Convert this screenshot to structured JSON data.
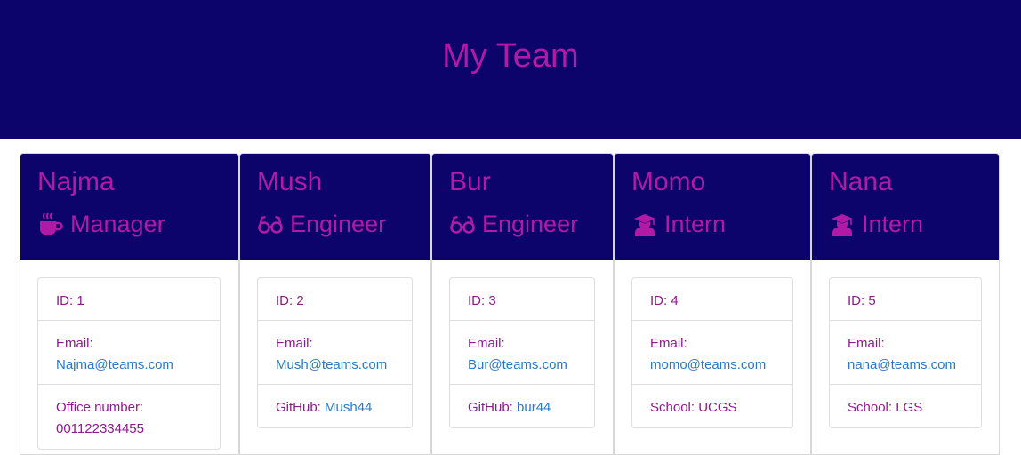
{
  "page": {
    "title": "My Team"
  },
  "colors": {
    "header_bg": "#0c036b",
    "accent": "#b01aa6",
    "link": "#2a79c9",
    "text": "#8c1b8a"
  },
  "employees": [
    {
      "name": "Najma",
      "role": "Manager",
      "icon": "coffee-mug-icon",
      "id": "ID: 1",
      "email_label": "Email:",
      "email": "Najma@teams.com",
      "extra_label": "Office number:",
      "extra_value": "001122334455"
    },
    {
      "name": "Mush",
      "role": "Engineer",
      "icon": "glasses-icon",
      "id": "ID: 2",
      "email_label": "Email:",
      "email": "Mush@teams.com",
      "extra_label": "GitHub:",
      "extra_value": "Mush44"
    },
    {
      "name": "Bur",
      "role": "Engineer",
      "icon": "glasses-icon",
      "id": "ID: 3",
      "email_label": "Email:",
      "email": "Bur@teams.com",
      "extra_label": "GitHub:",
      "extra_value": "bur44"
    },
    {
      "name": "Momo",
      "role": "Intern",
      "icon": "graduate-icon",
      "id": "ID: 4",
      "email_label": "Email:",
      "email": "momo@teams.com",
      "extra_label": "School:",
      "extra_value": "UCGS"
    },
    {
      "name": "Nana",
      "role": "Intern",
      "icon": "graduate-icon",
      "id": "ID: 5",
      "email_label": "Email:",
      "email": "nana@teams.com",
      "extra_label": "School:",
      "extra_value": "LGS"
    }
  ]
}
